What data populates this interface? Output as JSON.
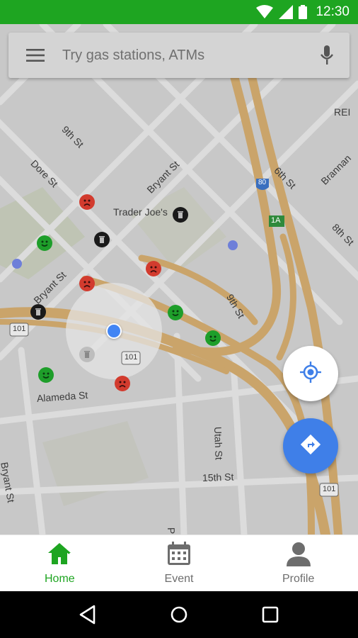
{
  "status_bar": {
    "time": "12:30",
    "icons": [
      "wifi-icon",
      "cellular-signal-icon",
      "battery-icon"
    ]
  },
  "search": {
    "placeholder": "Try gas stations, ATMs",
    "menu_icon": "hamburger-menu-icon",
    "mic_icon": "microphone-icon"
  },
  "map": {
    "labels": {
      "ninth_st_top": "9th St",
      "dore_st": "Dore St",
      "bryant_st_top": "Bryant St",
      "trader_joes": "Trader Joe's",
      "rei": "REI",
      "sixth_st": "6th St",
      "brannan": "Brannan",
      "eighth_st": "8th St",
      "bryant_st_mid": "Bryant St",
      "ninth_st_mid": "9th St",
      "alameda_st": "Alameda St",
      "utah_st": "Utah St",
      "bryant_st_bottom": "Bryant St",
      "fifteenth_st": "15th St",
      "potrero": "Potrero",
      "hwy_101_left": "101",
      "hwy_101_center": "101",
      "hwy_101_right": "101",
      "hwy_80": "80",
      "exit_1a": "1A"
    },
    "markers": {
      "happy_face_icon": "happy-face-icon",
      "sad_face_icon": "sad-face-icon",
      "trash_can_icon": "trash-can-icon"
    },
    "colors": {
      "happy": "#1e9e2a",
      "sad": "#d23b2e",
      "trash": "#1a1a1a",
      "my_location": "#4285f4",
      "freeway": "#c9a66b"
    }
  },
  "fab": {
    "locate_icon": "my-location-icon",
    "directions_icon": "directions-icon"
  },
  "bottom_nav": {
    "items": [
      {
        "label": "Home",
        "icon": "home-icon",
        "active": true
      },
      {
        "label": "Event",
        "icon": "calendar-icon",
        "active": false
      },
      {
        "label": "Profile",
        "icon": "person-icon",
        "active": false
      }
    ],
    "active_color": "#1ea521"
  },
  "system_nav": {
    "icons": [
      "back-icon",
      "home-circle-icon",
      "recents-icon"
    ]
  }
}
